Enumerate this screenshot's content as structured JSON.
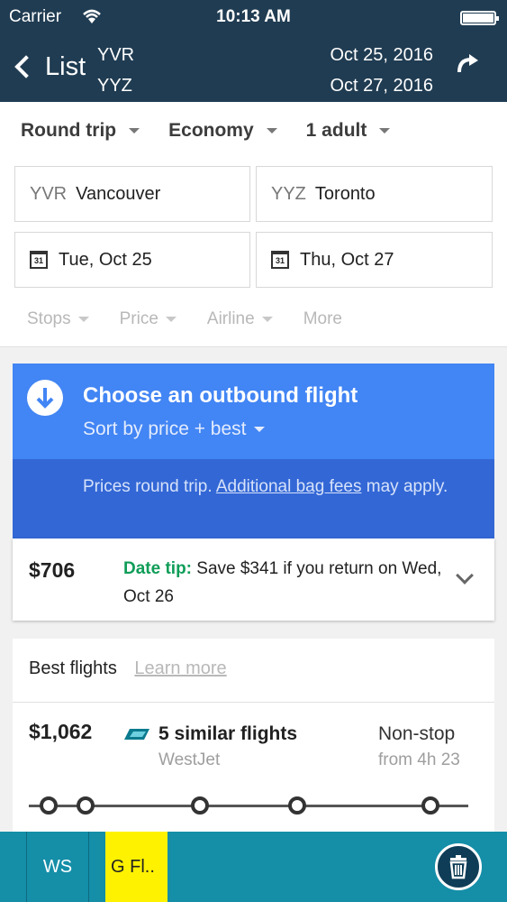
{
  "status_bar": {
    "carrier": "Carrier",
    "time": "10:13 AM"
  },
  "nav": {
    "back_label": "List",
    "origin_code": "YVR",
    "destination_code": "YYZ",
    "depart_date": "Oct 25, 2016",
    "return_date": "Oct 27, 2016"
  },
  "filters": {
    "trip_type": "Round trip",
    "cabin": "Economy",
    "passengers": "1 adult",
    "from_code": "YVR",
    "from_city": "Vancouver",
    "to_code": "YYZ",
    "to_city": "Toronto",
    "calendar_glyph": "31",
    "depart_date": "Tue, Oct 25",
    "return_date": "Thu, Oct 27",
    "chips": [
      "Stops",
      "Price",
      "Airline",
      "More"
    ]
  },
  "outbound": {
    "title": "Choose an outbound flight",
    "sort_label": "Sort by price + best",
    "notice_prefix": "Prices round trip.",
    "notice_link": "Additional bag fees",
    "notice_suffix": "may apply."
  },
  "date_tip": {
    "price": "$706",
    "lead": "Date tip:",
    "text": "Save $341 if you return on Wed, Oct 26"
  },
  "best_flights": {
    "heading": "Best flights",
    "learn_more": "Learn more",
    "flight": {
      "price": "$1,062",
      "title": "5 similar flights",
      "airline": "WestJet",
      "stops": "Non-stop",
      "duration": "from 4h 23"
    }
  },
  "tabbar": {
    "tab1": "WS",
    "tab2": "G Fl.."
  },
  "icons": {
    "back": "chevron-left-icon",
    "refresh": "refresh-icon",
    "calendar": "calendar-icon",
    "down_arrow": "arrow-down-circle-icon",
    "expand": "chevron-down-icon",
    "trash": "trash-icon",
    "airline_logo": "westjet-logo-icon"
  },
  "colors": {
    "nav_bg": "#203c52",
    "outbound_bg": "#4285f4",
    "notice_bg": "#3367d6",
    "tip_green": "#0f9d58",
    "tabbar_bg": "#158ea8",
    "highlight_tab": "#fff200"
  }
}
